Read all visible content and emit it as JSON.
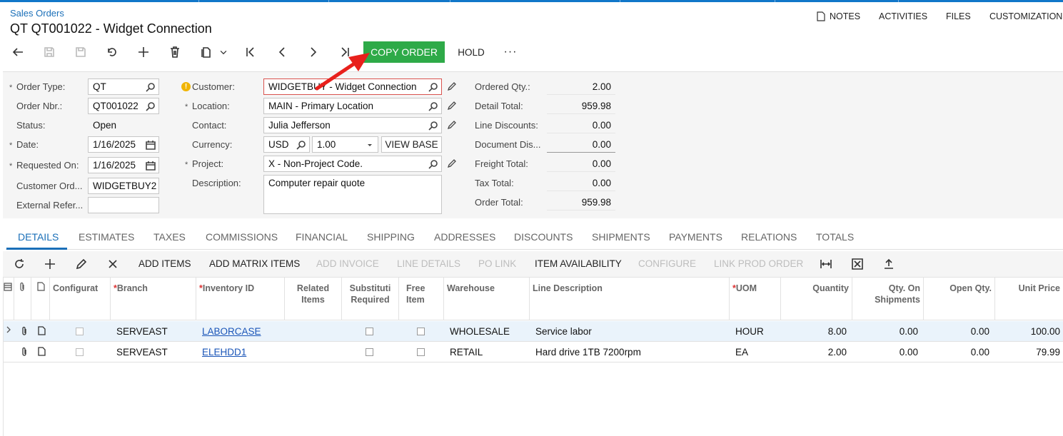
{
  "header": {
    "breadcrumb": "Sales Orders",
    "title": "QT QT001022 - Widget Connection",
    "actions": [
      "NOTES",
      "ACTIVITIES",
      "FILES",
      "CUSTOMIZATION"
    ]
  },
  "toolbar": {
    "copy_order": "COPY ORDER",
    "hold": "HOLD",
    "more": "···"
  },
  "form": {
    "order_type": {
      "label": "Order Type:",
      "value": "QT"
    },
    "order_nbr": {
      "label": "Order Nbr.:",
      "value": "QT001022"
    },
    "status": {
      "label": "Status:",
      "value": "Open"
    },
    "date": {
      "label": "Date:",
      "value": "1/16/2025"
    },
    "requested_on": {
      "label": "Requested On:",
      "value": "1/16/2025"
    },
    "customer_ord": {
      "label": "Customer Ord...",
      "value": "WIDGETBUY2"
    },
    "external_ref": {
      "label": "External Refer...",
      "value": ""
    },
    "customer": {
      "label": "Customer:",
      "value": "WIDGETBUY - Widget Connection"
    },
    "location": {
      "label": "Location:",
      "value": "MAIN - Primary Location"
    },
    "contact": {
      "label": "Contact:",
      "value": "Julia Jefferson"
    },
    "currency": {
      "label": "Currency:",
      "value": "USD",
      "rate": "1.00",
      "view_base": "VIEW BASE"
    },
    "project": {
      "label": "Project:",
      "value": "X - Non-Project Code."
    },
    "description": {
      "label": "Description:",
      "value": "Computer repair quote"
    }
  },
  "summary": [
    {
      "label": "Ordered Qty.:",
      "value": "2.00"
    },
    {
      "label": "Detail Total:",
      "value": "959.98"
    },
    {
      "label": "Line Discounts:",
      "value": "0.00"
    },
    {
      "label": "Document Dis...",
      "value": "0.00"
    },
    {
      "label": "Freight Total:",
      "value": "0.00"
    },
    {
      "label": "Tax Total:",
      "value": "0.00"
    },
    {
      "label": "Order Total:",
      "value": "959.98"
    }
  ],
  "tabs": [
    "DETAILS",
    "ESTIMATES",
    "TAXES",
    "COMMISSIONS",
    "FINANCIAL",
    "SHIPPING",
    "ADDRESSES",
    "DISCOUNTS",
    "SHIPMENTS",
    "PAYMENTS",
    "RELATIONS",
    "TOTALS"
  ],
  "grid_toolbar": {
    "add_items": "ADD ITEMS",
    "add_matrix_items": "ADD MATRIX ITEMS",
    "add_invoice": "ADD INVOICE",
    "line_details": "LINE DETAILS",
    "po_link": "PO LINK",
    "item_availability": "ITEM AVAILABILITY",
    "configure": "CONFIGURE",
    "link_prod_order": "LINK PROD ORDER"
  },
  "columns": {
    "configurat": "Configurat",
    "branch": "Branch",
    "inventory_id": "Inventory ID",
    "related_items": "Related Items",
    "substituti": "Substituti Required",
    "free_item": "Free Item",
    "warehouse": "Warehouse",
    "line_description": "Line Description",
    "uom": "UOM",
    "quantity": "Quantity",
    "qty_on_shipments": "Qty. On Shipments",
    "open_qty": "Open Qty.",
    "unit_price": "Unit Price"
  },
  "rows": [
    {
      "branch": "SERVEAST",
      "inventory_id": "LABORCASE",
      "warehouse": "WHOLESALE",
      "description": "Service labor",
      "uom": "HOUR",
      "quantity": "8.00",
      "qty_on_shipments": "0.00",
      "open_qty": "0.00",
      "unit_price": "100.00"
    },
    {
      "branch": "SERVEAST",
      "inventory_id": "ELEHDD1",
      "warehouse": "RETAIL",
      "description": "Hard drive 1TB 7200rpm",
      "uom": "EA",
      "quantity": "2.00",
      "qty_on_shipments": "0.00",
      "open_qty": "0.00",
      "unit_price": "79.99"
    }
  ],
  "colors": {
    "accent": "#1a6fb8",
    "copy_button": "#2eaa48",
    "arrow": "#e8201c"
  }
}
